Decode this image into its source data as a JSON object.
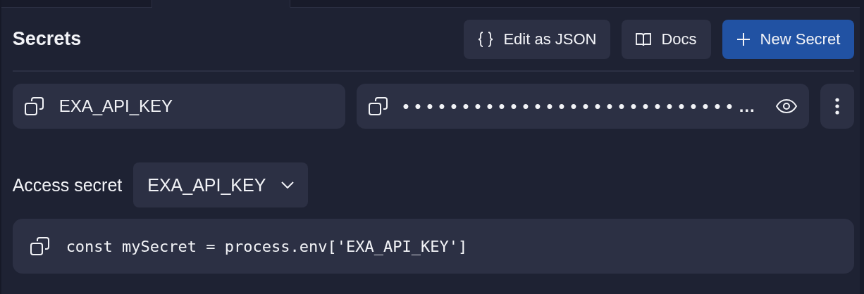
{
  "tabs": [
    {
      "selected": false
    },
    {
      "selected": true
    },
    {
      "selected": false
    }
  ],
  "title": "Secrets",
  "actions": [
    {
      "kind": "braces",
      "label": "Edit as JSON",
      "primary": false
    },
    {
      "kind": "book",
      "label": "Docs",
      "primary": false
    },
    {
      "kind": "plus",
      "label": "New Secret",
      "primary": true
    }
  ],
  "secrets": [
    {
      "key": "EXA_API_KEY",
      "value": "••••••••••••••••••••••••••••…"
    }
  ],
  "access": {
    "label": "Access secret",
    "selected": "EXA_API_KEY",
    "code": "const mySecret = process.env['EXA_API_KEY']"
  }
}
